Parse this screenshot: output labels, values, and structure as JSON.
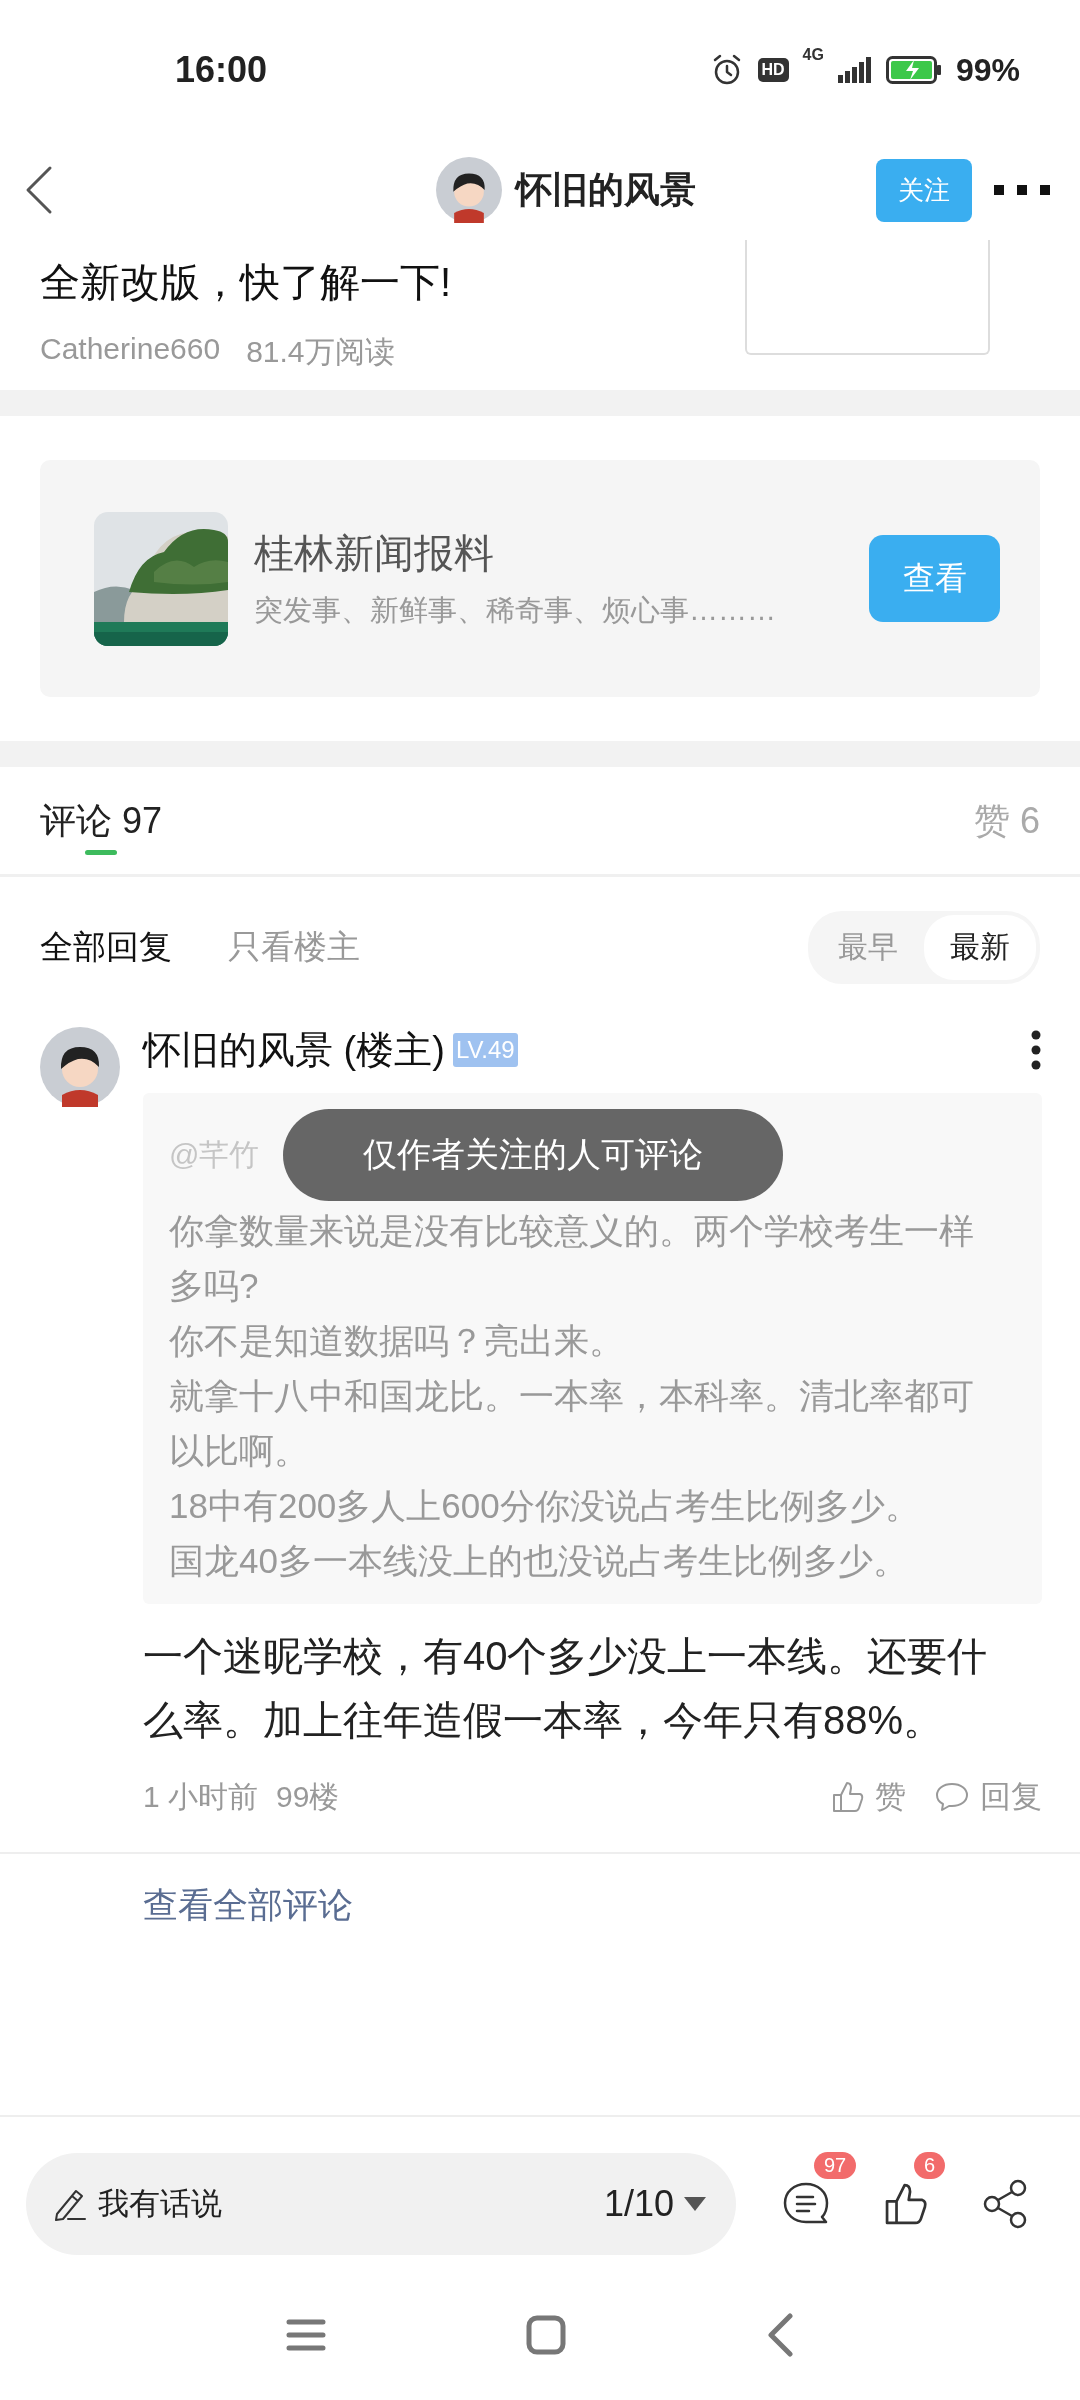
{
  "status_bar": {
    "time": "16:00",
    "hd": "HD",
    "network": "4G",
    "battery": "99%"
  },
  "header": {
    "title": "怀旧的风景",
    "follow_button": "关注"
  },
  "article": {
    "title": "全新改版，快了解一下!",
    "author": "Catherine660",
    "reads": "81.4万阅读"
  },
  "promo": {
    "title": "桂林新闻报料",
    "subtitle": "突发事、新鲜事、稀奇事、烦心事………",
    "button": "查看"
  },
  "tabs": [
    {
      "label": "评论 97",
      "selected": true
    },
    {
      "label": "赞 6",
      "selected": false
    }
  ],
  "filters": [
    {
      "label": "全部回复",
      "selected": true
    },
    {
      "label": "只看楼主",
      "selected": false
    }
  ],
  "sort": [
    {
      "label": "最早",
      "selected": false
    },
    {
      "label": "最新",
      "selected": true
    }
  ],
  "comment": {
    "author": "怀旧的风景 (楼主)",
    "level": "LV.49",
    "quote": {
      "header": "@芊竹",
      "lines": [
        "你拿数量来说是没有比较意义的。两个学校考生一样多吗?",
        "你不是知道数据吗？亮出来。",
        "就拿十八中和国龙比。一本率，本科率。清北率都可以比啊。",
        "18中有200多人上600分你没说占考生比例多少。",
        "国龙40多一本线没上的也没说占考生比例多少。"
      ]
    },
    "text": "一个迷昵学校，有40个多少没上一本线。还要什么率。加上往年造假一本率，今年只有88%。",
    "time": "1 小时前",
    "floor": "99楼",
    "like": "赞",
    "reply": "回复"
  },
  "view_all": "查看全部评论",
  "toast": "仅作者关注的人可评论",
  "bottom_bar": {
    "placeholder": "我有话说",
    "page": "1/10",
    "comment_count": "97",
    "like_count": "6"
  }
}
